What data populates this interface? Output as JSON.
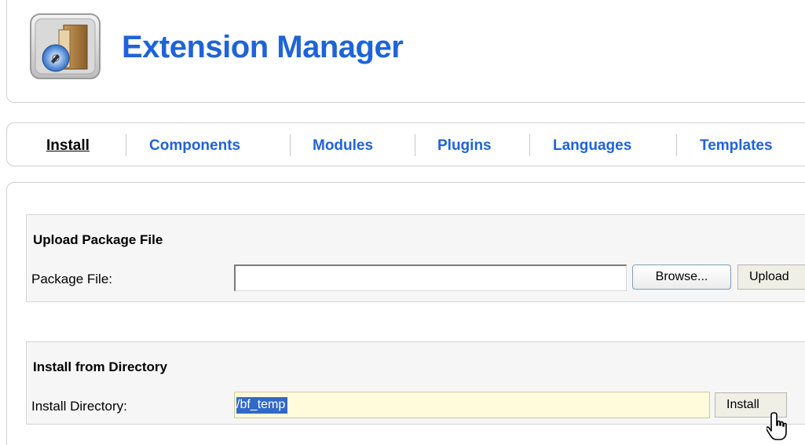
{
  "header": {
    "title": "Extension Manager",
    "icon": "extension-package-icon"
  },
  "tabs": [
    {
      "label": "Install",
      "active": true
    },
    {
      "label": "Components",
      "active": false
    },
    {
      "label": "Modules",
      "active": false
    },
    {
      "label": "Plugins",
      "active": false
    },
    {
      "label": "Languages",
      "active": false
    },
    {
      "label": "Templates",
      "active": false
    }
  ],
  "upload": {
    "title": "Upload Package File",
    "field_label": "Package File:",
    "field_value": "",
    "browse_label": "Browse...",
    "upload_label": "Upload"
  },
  "directory": {
    "title": "Install from Directory",
    "field_label": "Install Directory:",
    "field_value": "/bf_temp",
    "install_label": "Install"
  },
  "colors": {
    "accent": "#1f63d8",
    "selection": "#3169c6",
    "input_highlight": "#fffbdb"
  }
}
